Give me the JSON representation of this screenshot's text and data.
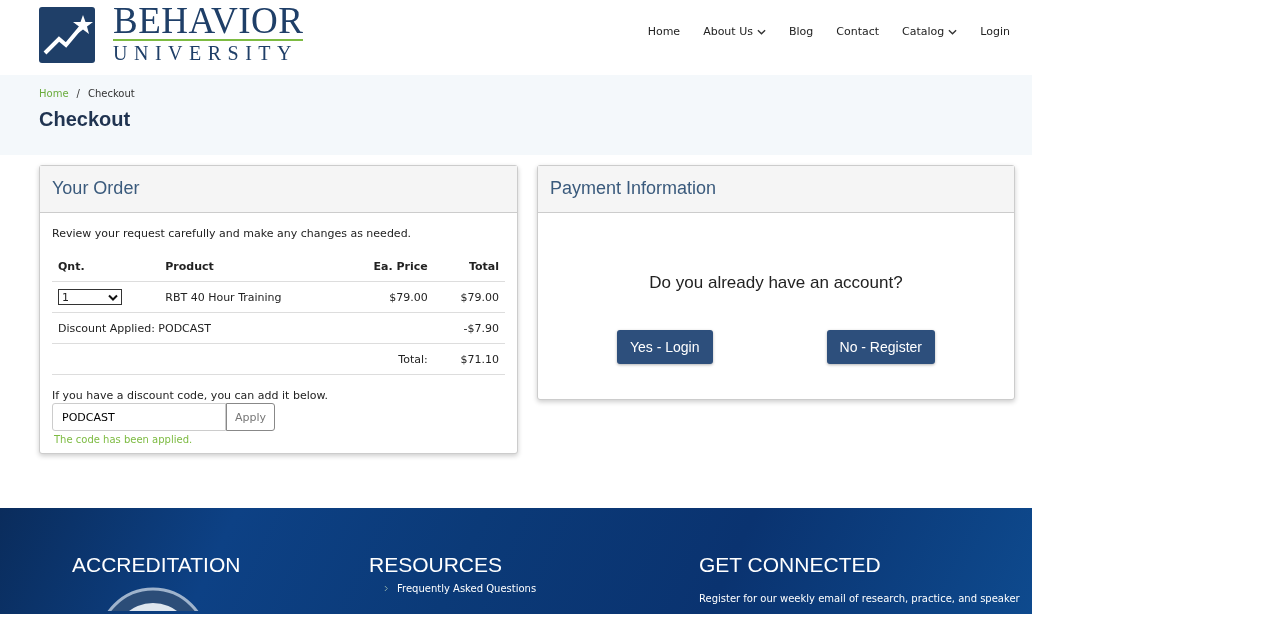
{
  "logo": {
    "title": "BEHAVIOR",
    "subtitle": "UNIVERSITY"
  },
  "nav": [
    {
      "label": "Home",
      "dropdown": false
    },
    {
      "label": "About Us",
      "dropdown": true
    },
    {
      "label": "Blog",
      "dropdown": false
    },
    {
      "label": "Contact",
      "dropdown": false
    },
    {
      "label": "Catalog",
      "dropdown": true
    },
    {
      "label": "Login",
      "dropdown": false
    }
  ],
  "breadcrumb_separator": "/",
  "breadcrumb": [
    {
      "label": "Home",
      "link": true
    },
    {
      "label": "Checkout",
      "link": false
    }
  ],
  "page_title": "Checkout",
  "order": {
    "title": "Your Order",
    "intro": "Review your request carefully and make any changes as needed.",
    "columns": [
      "Qnt.",
      "Product",
      "Ea. Price",
      "Total"
    ],
    "rows": [
      {
        "kind": "item",
        "quantity": "1",
        "product": "RBT 40 Hour Training",
        "price": "$79.00",
        "total": "$79.00"
      },
      {
        "kind": "discount",
        "label": "Discount Applied: PODCAST",
        "total": "-$7.90"
      },
      {
        "kind": "sum",
        "label": "Total:",
        "total": "$71.10"
      }
    ],
    "discount_prompt": "If you have a discount code, you can add it below.",
    "discount_code": "PODCAST",
    "apply_button": "Apply",
    "success_message": "The code has been applied."
  },
  "payment": {
    "title": "Payment Information",
    "question": "Do you already have an account?",
    "buttons": [
      "Yes - Login",
      "No - Register"
    ]
  },
  "footer": {
    "columns": [
      {
        "heading": "ACCREDITATION",
        "kind": "seal"
      },
      {
        "heading": "RESOURCES",
        "kind": "links",
        "links": [
          "Frequently Asked Questions"
        ]
      },
      {
        "heading": "GET CONNECTED",
        "kind": "text",
        "text": "Register for our weekly email of research, practice, and speaker"
      }
    ]
  }
}
